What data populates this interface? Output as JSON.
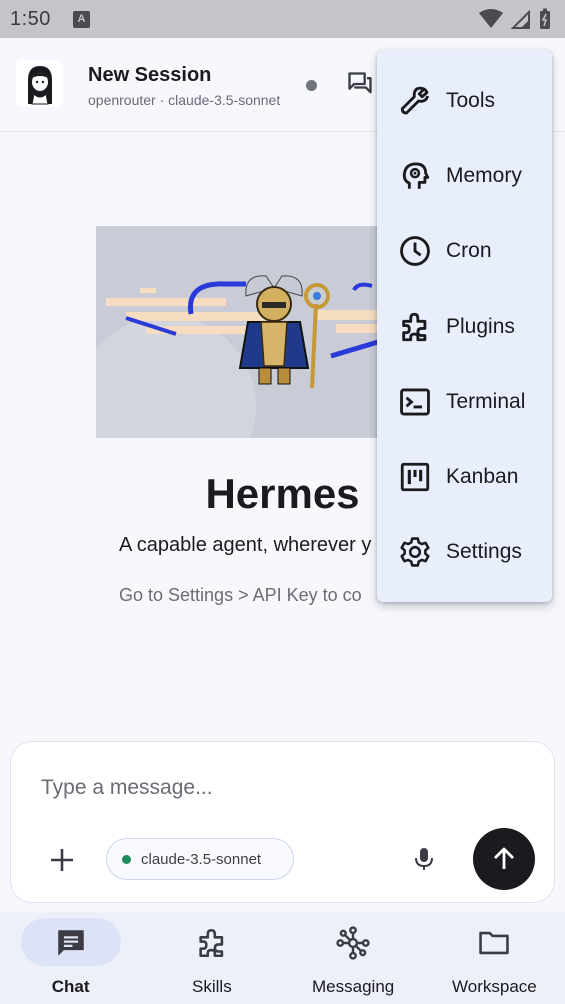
{
  "status_bar": {
    "time": "1:50",
    "notification_glyph": "A"
  },
  "header": {
    "title": "New Session",
    "subtitle": "openrouter · claude-3.5-sonnet",
    "icons": [
      "avatar",
      "status-dot",
      "forum-icon"
    ]
  },
  "hero": {
    "title": "Hermes",
    "tagline": "A capable agent, wherever y",
    "hint": "Go to Settings > API Key to co"
  },
  "composer": {
    "placeholder": "Type a message...",
    "value": "",
    "model_chip": "claude-3.5-sonnet",
    "model_status_color": "#1e8a5a"
  },
  "menu": {
    "items": [
      {
        "label": "Tools",
        "icon": "wrench-icon"
      },
      {
        "label": "Memory",
        "icon": "brain-icon"
      },
      {
        "label": "Cron",
        "icon": "clock-icon"
      },
      {
        "label": "Plugins",
        "icon": "puzzle-icon"
      },
      {
        "label": "Terminal",
        "icon": "terminal-icon"
      },
      {
        "label": "Kanban",
        "icon": "kanban-icon"
      },
      {
        "label": "Settings",
        "icon": "gear-icon"
      }
    ]
  },
  "bottom_nav": {
    "items": [
      {
        "label": "Chat",
        "icon": "chat-icon",
        "active": true
      },
      {
        "label": "Skills",
        "icon": "puzzle-icon",
        "active": false
      },
      {
        "label": "Messaging",
        "icon": "hub-icon",
        "active": false
      },
      {
        "label": "Workspace",
        "icon": "folder-icon",
        "active": false
      }
    ]
  },
  "colors": {
    "background": "#f7f8fe",
    "status_bar": "#c4c5cb",
    "menu_background": "#e8eefc",
    "nav_background": "#eef0f9",
    "nav_active_pill": "#dde3f6",
    "send_button": "#1b1b1f"
  }
}
